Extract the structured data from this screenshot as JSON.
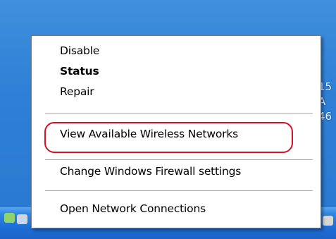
{
  "desktop_text": [
    "15",
    "A",
    "46"
  ],
  "context_menu": {
    "items": [
      {
        "label": "Disable"
      },
      {
        "label": "Status"
      },
      {
        "label": "Repair"
      },
      {
        "label": "View Available Wireless Networks"
      },
      {
        "label": "Change Windows Firewall settings"
      },
      {
        "label": "Open Network Connections"
      }
    ]
  },
  "annotation": {
    "ring_color": "#d8102a"
  },
  "tray_icons": [
    "network-icon",
    "monitor-icon",
    "flag-icon",
    "security-icon",
    "app-icon",
    "app-icon",
    "app-icon",
    "app-icon",
    "app-icon",
    "volume-icon",
    "app-icon"
  ]
}
